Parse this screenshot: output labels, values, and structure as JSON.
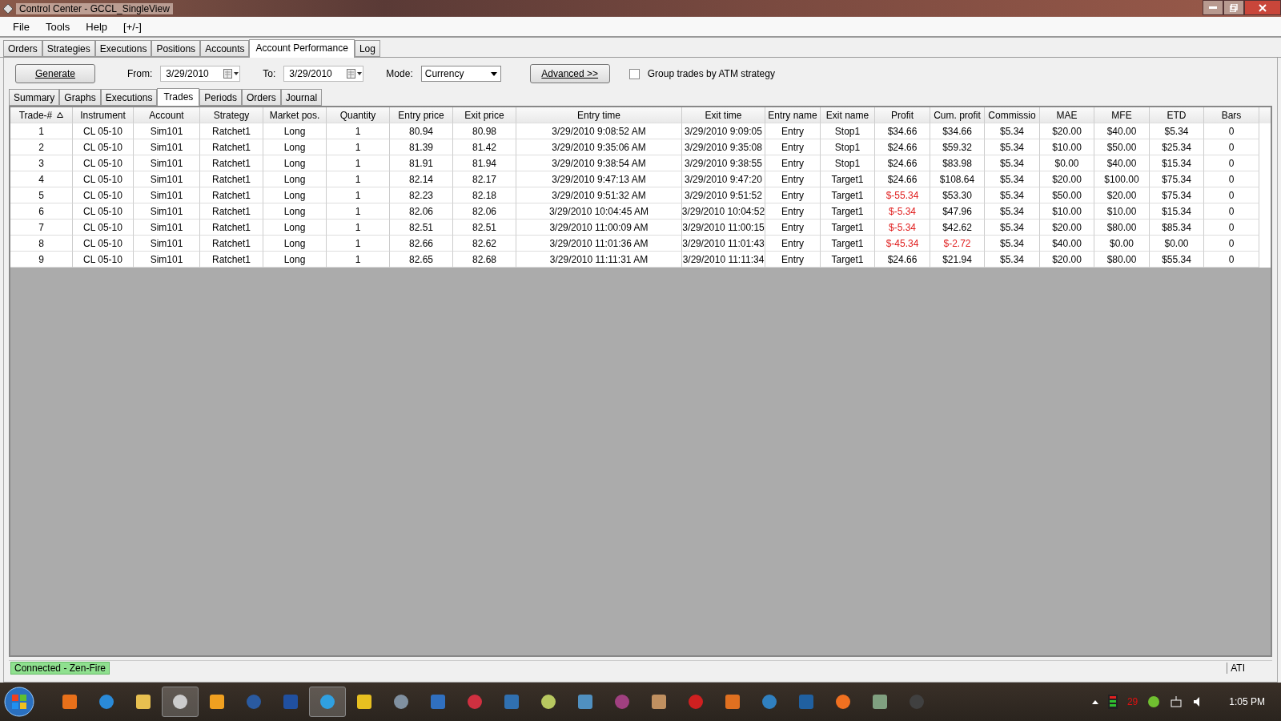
{
  "window": {
    "title": "Control Center - GCCL_SingleView"
  },
  "menu": [
    "File",
    "Tools",
    "Help",
    "[+/-]"
  ],
  "tabs": [
    {
      "label": "Orders",
      "selected": false
    },
    {
      "label": "Strategies",
      "selected": false
    },
    {
      "label": "Executions",
      "selected": false
    },
    {
      "label": "Positions",
      "selected": false
    },
    {
      "label": "Accounts",
      "selected": false
    },
    {
      "label": "Account Performance",
      "selected": true
    },
    {
      "label": "Log",
      "selected": false
    }
  ],
  "toolbar": {
    "generate": "Generate",
    "from_label": "From:",
    "from": "3/29/2010",
    "to_label": "To:",
    "to": "3/29/2010",
    "mode_label": "Mode:",
    "mode": "Currency",
    "advanced": "Advanced >>",
    "group_label": "Group trades by ATM strategy",
    "group_checked": false
  },
  "subtabs": [
    {
      "label": "Summary",
      "selected": false
    },
    {
      "label": "Graphs",
      "selected": false
    },
    {
      "label": "Executions",
      "selected": false
    },
    {
      "label": "Trades",
      "selected": true
    },
    {
      "label": "Periods",
      "selected": false
    },
    {
      "label": "Orders",
      "selected": false
    },
    {
      "label": "Journal",
      "selected": false
    }
  ],
  "table": {
    "columns": [
      {
        "label": "Trade-#",
        "sorted": true
      },
      {
        "label": "Instrument",
        "sorted": false
      },
      {
        "label": "Account",
        "sorted": false
      },
      {
        "label": "Strategy",
        "sorted": false
      },
      {
        "label": "Market pos.",
        "sorted": false
      },
      {
        "label": "Quantity",
        "sorted": false
      },
      {
        "label": "Entry price",
        "sorted": false
      },
      {
        "label": "Exit price",
        "sorted": false
      },
      {
        "label": "Entry time",
        "sorted": false
      },
      {
        "label": "Exit time",
        "sorted": false
      },
      {
        "label": "Entry name",
        "sorted": false
      },
      {
        "label": "Exit name",
        "sorted": false
      },
      {
        "label": "Profit",
        "sorted": false
      },
      {
        "label": "Cum. profit",
        "sorted": false
      },
      {
        "label": "Commissio",
        "sorted": false
      },
      {
        "label": "MAE",
        "sorted": false
      },
      {
        "label": "MFE",
        "sorted": false
      },
      {
        "label": "ETD",
        "sorted": false
      },
      {
        "label": "Bars",
        "sorted": false
      }
    ],
    "rows": [
      {
        "cells": [
          "1",
          "CL 05-10",
          "Sim101",
          "Ratchet1",
          "Long",
          "1",
          "80.94",
          "80.98",
          "3/29/2010 9:08:52 AM",
          "3/29/2010 9:09:05",
          "Entry",
          "Stop1",
          "$34.66",
          "$34.66",
          "$5.34",
          "$20.00",
          "$40.00",
          "$5.34",
          "0"
        ],
        "profit_negative": false,
        "cum_profit_negative": false
      },
      {
        "cells": [
          "2",
          "CL 05-10",
          "Sim101",
          "Ratchet1",
          "Long",
          "1",
          "81.39",
          "81.42",
          "3/29/2010 9:35:06 AM",
          "3/29/2010 9:35:08",
          "Entry",
          "Stop1",
          "$24.66",
          "$59.32",
          "$5.34",
          "$10.00",
          "$50.00",
          "$25.34",
          "0"
        ],
        "profit_negative": false,
        "cum_profit_negative": false
      },
      {
        "cells": [
          "3",
          "CL 05-10",
          "Sim101",
          "Ratchet1",
          "Long",
          "1",
          "81.91",
          "81.94",
          "3/29/2010 9:38:54 AM",
          "3/29/2010 9:38:55",
          "Entry",
          "Stop1",
          "$24.66",
          "$83.98",
          "$5.34",
          "$0.00",
          "$40.00",
          "$15.34",
          "0"
        ],
        "profit_negative": false,
        "cum_profit_negative": false
      },
      {
        "cells": [
          "4",
          "CL 05-10",
          "Sim101",
          "Ratchet1",
          "Long",
          "1",
          "82.14",
          "82.17",
          "3/29/2010 9:47:13 AM",
          "3/29/2010 9:47:20",
          "Entry",
          "Target1",
          "$24.66",
          "$108.64",
          "$5.34",
          "$20.00",
          "$100.00",
          "$75.34",
          "0"
        ],
        "profit_negative": false,
        "cum_profit_negative": false
      },
      {
        "cells": [
          "5",
          "CL 05-10",
          "Sim101",
          "Ratchet1",
          "Long",
          "1",
          "82.23",
          "82.18",
          "3/29/2010 9:51:32 AM",
          "3/29/2010 9:51:52",
          "Entry",
          "Target1",
          "$-55.34",
          "$53.30",
          "$5.34",
          "$50.00",
          "$20.00",
          "$75.34",
          "0"
        ],
        "profit_negative": true,
        "cum_profit_negative": false
      },
      {
        "cells": [
          "6",
          "CL 05-10",
          "Sim101",
          "Ratchet1",
          "Long",
          "1",
          "82.06",
          "82.06",
          "3/29/2010 10:04:45 AM",
          "3/29/2010 10:04:52",
          "Entry",
          "Target1",
          "$-5.34",
          "$47.96",
          "$5.34",
          "$10.00",
          "$10.00",
          "$15.34",
          "0"
        ],
        "profit_negative": true,
        "cum_profit_negative": false
      },
      {
        "cells": [
          "7",
          "CL 05-10",
          "Sim101",
          "Ratchet1",
          "Long",
          "1",
          "82.51",
          "82.51",
          "3/29/2010 11:00:09 AM",
          "3/29/2010 11:00:15",
          "Entry",
          "Target1",
          "$-5.34",
          "$42.62",
          "$5.34",
          "$20.00",
          "$80.00",
          "$85.34",
          "0"
        ],
        "profit_negative": true,
        "cum_profit_negative": false
      },
      {
        "cells": [
          "8",
          "CL 05-10",
          "Sim101",
          "Ratchet1",
          "Long",
          "1",
          "82.66",
          "82.62",
          "3/29/2010 11:01:36 AM",
          "3/29/2010 11:01:43",
          "Entry",
          "Target1",
          "$-45.34",
          "$-2.72",
          "$5.34",
          "$40.00",
          "$0.00",
          "$0.00",
          "0"
        ],
        "profit_negative": true,
        "cum_profit_negative": true
      },
      {
        "cells": [
          "9",
          "CL 05-10",
          "Sim101",
          "Ratchet1",
          "Long",
          "1",
          "82.65",
          "82.68",
          "3/29/2010 11:11:31 AM",
          "3/29/2010 11:11:34",
          "Entry",
          "Target1",
          "$24.66",
          "$21.94",
          "$5.34",
          "$20.00",
          "$80.00",
          "$55.34",
          "0"
        ],
        "profit_negative": false,
        "cum_profit_negative": false
      }
    ]
  },
  "status_bar": {
    "connection": "Connected - Zen-Fire",
    "right": "ATI"
  },
  "taskbar": {
    "tray_count": "29",
    "clock": "1:05 PM"
  }
}
